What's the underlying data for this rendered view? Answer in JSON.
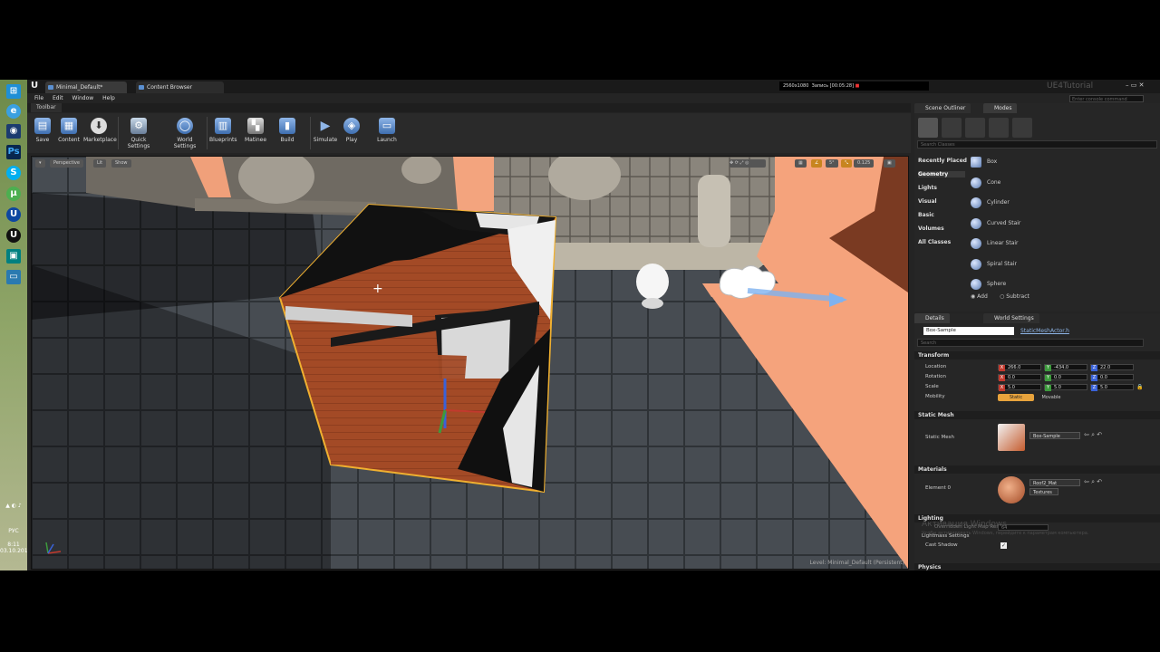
{
  "tabs": [
    "Minimal_Default*",
    "Content Browser"
  ],
  "menu": [
    "File",
    "Edit",
    "Window",
    "Help"
  ],
  "recording": {
    "resolution": "2560x1080",
    "status": "Запись [00:05:28]"
  },
  "brand": "UE4Tutorial",
  "console_placeholder": "Enter console command",
  "toolbar_title": "Toolbar",
  "toolbar": [
    {
      "label": "Save",
      "icon": "save-icon"
    },
    {
      "label": "Content",
      "icon": "content-icon"
    },
    {
      "label": "Marketplace",
      "icon": "marketplace-icon"
    },
    {
      "label": "Quick Settings",
      "icon": "quick-settings-icon"
    },
    {
      "label": "World Settings",
      "icon": "world-settings-icon"
    },
    {
      "label": "Blueprints",
      "icon": "blueprints-icon"
    },
    {
      "label": "Matinee",
      "icon": "matinee-icon"
    },
    {
      "label": "Build",
      "icon": "build-icon"
    },
    {
      "label": "Simulate",
      "icon": "simulate-icon"
    },
    {
      "label": "Play",
      "icon": "play-icon"
    },
    {
      "label": "Launch",
      "icon": "launch-icon"
    }
  ],
  "viewport": {
    "perspective": "Perspective",
    "lit": "Lit",
    "show": "Show",
    "grid_snap": "5°",
    "scale_snap": "0.125",
    "level_label": "Level:  Minimal_Default (Persistent)"
  },
  "right_tabs": {
    "outliner": "Scene Outliner",
    "modes": "Modes"
  },
  "search_classes": "Search Classes",
  "categories": [
    "Recently Placed",
    "Geometry",
    "Lights",
    "Visual",
    "Basic",
    "Volumes",
    "All Classes"
  ],
  "place_items": [
    "Box",
    "Cone",
    "Cylinder",
    "Curved Stair",
    "Linear Stair",
    "Spiral Stair",
    "Sphere"
  ],
  "brush_ops": {
    "add": "Add",
    "subtract": "Subtract"
  },
  "details_tabs": {
    "details": "Details",
    "world_settings": "World Settings"
  },
  "details": {
    "actor_name": "Box-Sample",
    "actor_class": "StaticMeshActor.h",
    "search": "Search",
    "transform": "Transform",
    "location_label": "Location",
    "rotation_label": "Rotation",
    "scale_label": "Scale",
    "mobility_label": "Mobility",
    "location": [
      "266.0",
      "-434.0",
      "22.0"
    ],
    "rotation": [
      "0.0",
      "0.0",
      "0.0"
    ],
    "scale": [
      "5.0",
      "5.0",
      "5.0"
    ],
    "mobility": [
      "Static",
      "Movable"
    ],
    "static_mesh_section": "Static Mesh",
    "static_mesh_label": "Static Mesh",
    "static_mesh_value": "Box-Sample",
    "materials_section": "Materials",
    "element_label": "Element 0",
    "material_value": "Roof2_Mat",
    "textures": "Textures",
    "lighting_section": "Lighting",
    "override_lightmap": "Overridden Light Map Res",
    "override_value": "64",
    "lightmass": "Lightmass Settings",
    "cast_shadow": "Cast Shadow",
    "physics_section": "Physics",
    "watermark": "Активация Windows",
    "watermark_sub": "Чтобы активировать Windows, перейдите к параметрам компьютера."
  },
  "tray": {
    "lang": "РУС",
    "time": "8:11",
    "date": "03.10.2014"
  },
  "colors": {
    "accent": "#e8a33c",
    "selection": "#f0b030",
    "panel": "#262626"
  }
}
